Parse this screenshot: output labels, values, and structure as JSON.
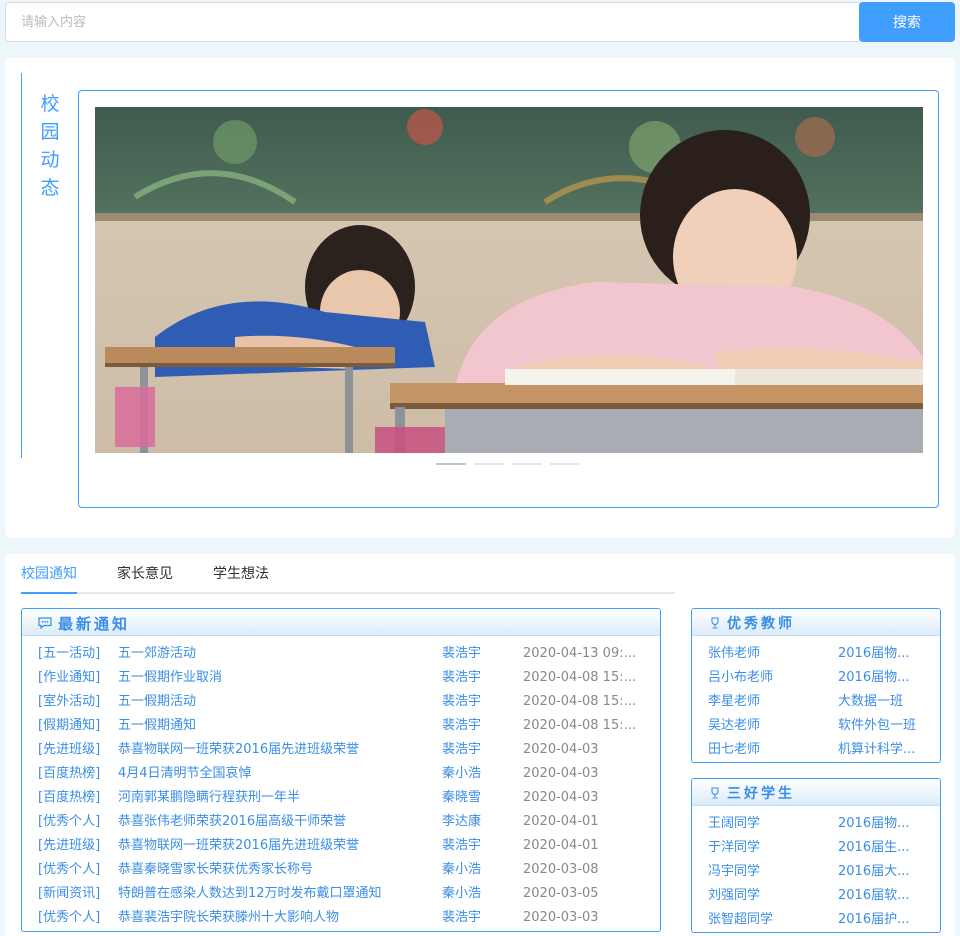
{
  "search": {
    "placeholder": "请输入内容",
    "button_label": "搜索"
  },
  "news": {
    "title": "校园动态",
    "image_alt": "学生上课写作业",
    "carousel_dots": 4,
    "active_dot": 0
  },
  "tabs": [
    {
      "label": "校园通知",
      "active": true
    },
    {
      "label": "家长意见",
      "active": false
    },
    {
      "label": "学生想法",
      "active": false
    }
  ],
  "notices": {
    "title": "最新通知",
    "icon": "chat-bubble-icon",
    "rows": [
      {
        "category": "[五一活动]",
        "title": "五一郊游活动",
        "author": "裴浩宇",
        "date": "2020-04-13 09:..."
      },
      {
        "category": "[作业通知]",
        "title": "五一假期作业取消",
        "author": "裴浩宇",
        "date": "2020-04-08 15:..."
      },
      {
        "category": "[室外活动]",
        "title": "五一假期活动",
        "author": "裴浩宇",
        "date": "2020-04-08 15:..."
      },
      {
        "category": "[假期通知]",
        "title": "五一假期通知",
        "author": "裴浩宇",
        "date": "2020-04-08 15:..."
      },
      {
        "category": "[先进班级]",
        "title": "恭喜物联网一班荣获2016届先进班级荣誉",
        "author": "裴浩宇",
        "date": "2020-04-03"
      },
      {
        "category": "[百度热榜]",
        "title": "4月4日清明节全国哀悼",
        "author": "秦小浩",
        "date": "2020-04-03"
      },
      {
        "category": "[百度热榜]",
        "title": "河南郭某鹏隐瞒行程获刑一年半",
        "author": "秦晓雪",
        "date": "2020-04-03"
      },
      {
        "category": "[优秀个人]",
        "title": "恭喜张伟老师荣获2016届高级干师荣誉",
        "author": "李达康",
        "date": "2020-04-01"
      },
      {
        "category": "[先进班级]",
        "title": "恭喜物联网一班荣获2016届先进班级荣誉",
        "author": "裴浩宇",
        "date": "2020-04-01"
      },
      {
        "category": "[优秀个人]",
        "title": "恭喜秦晓雪家长荣获优秀家长称号",
        "author": "秦小浩",
        "date": "2020-03-08"
      },
      {
        "category": "[新闻资讯]",
        "title": "特朗普在感染人数达到12万时发布戴口罩通知",
        "author": "秦小浩",
        "date": "2020-03-05"
      },
      {
        "category": "[优秀个人]",
        "title": "恭喜裴浩宇院长荣获滕州十大影响人物",
        "author": "裴浩宇",
        "date": "2020-03-03"
      }
    ]
  },
  "teachers": {
    "title": "优秀教师",
    "icon": "trophy-icon",
    "rows": [
      {
        "name": "张伟老师",
        "info": "2016届物..."
      },
      {
        "name": "吕小布老师",
        "info": "2016届物..."
      },
      {
        "name": "李星老师",
        "info": "大数据一班"
      },
      {
        "name": "吴达老师",
        "info": "软件外包一班"
      },
      {
        "name": "田七老师",
        "info": "机算计科学..."
      }
    ]
  },
  "students": {
    "title": "三好学生",
    "icon": "trophy-icon",
    "rows": [
      {
        "name": "王阔同学",
        "info": "2016届物..."
      },
      {
        "name": "于洋同学",
        "info": "2016届生..."
      },
      {
        "name": "冯宇同学",
        "info": "2016届大..."
      },
      {
        "name": "刘强同学",
        "info": "2016届软..."
      },
      {
        "name": "张智超同学",
        "info": "2016届护..."
      }
    ]
  },
  "colors": {
    "accent": "#409eff",
    "link": "#3a8ee6",
    "background": "#edf7fb"
  }
}
